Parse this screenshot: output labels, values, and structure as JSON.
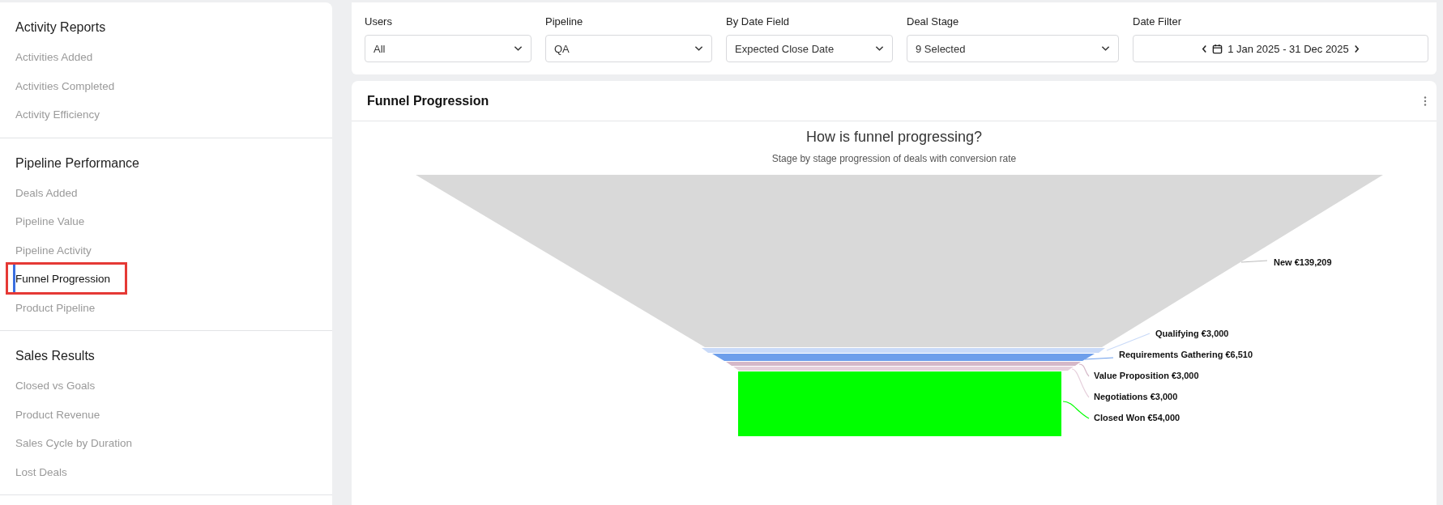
{
  "sidebar": {
    "sections": [
      {
        "title": "Activity Reports",
        "items": [
          {
            "label": "Activities Added",
            "selected": false
          },
          {
            "label": "Activities Completed",
            "selected": false
          },
          {
            "label": "Activity Efficiency",
            "selected": false
          }
        ]
      },
      {
        "title": "Pipeline Performance",
        "items": [
          {
            "label": "Deals Added",
            "selected": false
          },
          {
            "label": "Pipeline Value",
            "selected": false
          },
          {
            "label": "Pipeline Activity",
            "selected": false
          },
          {
            "label": "Funnel Progression",
            "selected": true,
            "highlighted": true
          },
          {
            "label": "Product Pipeline",
            "selected": false
          }
        ]
      },
      {
        "title": "Sales Results",
        "items": [
          {
            "label": "Closed vs Goals",
            "selected": false
          },
          {
            "label": "Product Revenue",
            "selected": false
          },
          {
            "label": "Sales Cycle by Duration",
            "selected": false
          },
          {
            "label": "Lost Deals",
            "selected": false
          }
        ]
      }
    ]
  },
  "filters": [
    {
      "kind": "select",
      "label": "Users",
      "value": "All"
    },
    {
      "kind": "select",
      "label": "Pipeline",
      "value": "QA"
    },
    {
      "kind": "select",
      "label": "By Date Field",
      "value": "Expected Close Date"
    },
    {
      "kind": "select",
      "label": "Deal Stage",
      "value": "9 Selected"
    },
    {
      "kind": "daterange",
      "label": "Date Filter",
      "value": "1 Jan 2025 - 31 Dec 2025"
    }
  ],
  "report": {
    "title": "Funnel Progression",
    "chart_title": "How is funnel progressing?",
    "chart_subtitle": "Stage by stage progression of deals with conversion rate",
    "stages": [
      {
        "label": "New €139,209",
        "color": "#d9d9d9"
      },
      {
        "label": "Qualifying €3,000",
        "color": "#c9daf8"
      },
      {
        "label": "Requirements Gathering €6,510",
        "color": "#6d9eeb"
      },
      {
        "label": "Value Proposition €3,000",
        "color": "#d5b8c8"
      },
      {
        "label": "Negotiations €3,000",
        "color": "#e6d0dc"
      },
      {
        "label": "Closed Won €54,000",
        "color": "#00ff00"
      }
    ]
  }
}
